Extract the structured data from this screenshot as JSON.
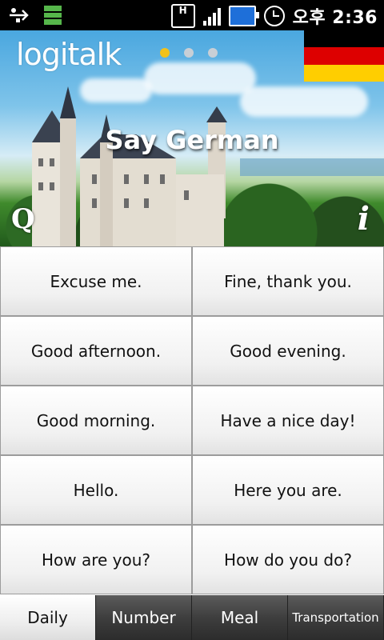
{
  "status_bar": {
    "time": "오후 2:36",
    "icons": [
      "usb-icon",
      "storage-icon",
      "h-data-icon",
      "signal-icon",
      "battery-charging-icon",
      "alarm-icon"
    ],
    "h_badge": "H"
  },
  "hero": {
    "logo": "logitalk",
    "title": "Say German",
    "page_dots": {
      "count": 3,
      "active_index": 0
    },
    "flag_colors": [
      "#000000",
      "#dd0000",
      "#ffce00"
    ],
    "left_icon": "Q",
    "right_icon": "i"
  },
  "phrases": [
    "Excuse me.",
    "Fine, thank you.",
    "Good afternoon.",
    "Good evening.",
    "Good morning.",
    "Have a nice day!",
    "Hello.",
    "Here you are.",
    "How are you?",
    "How do you do?"
  ],
  "tabs": [
    {
      "label": "Daily",
      "active": true
    },
    {
      "label": "Number",
      "active": false
    },
    {
      "label": "Meal",
      "active": false
    },
    {
      "label": "Transportation",
      "active": false
    }
  ],
  "colors": {
    "active_dot": "#f2c21b",
    "inactive_dot": "#c8cfd6"
  }
}
